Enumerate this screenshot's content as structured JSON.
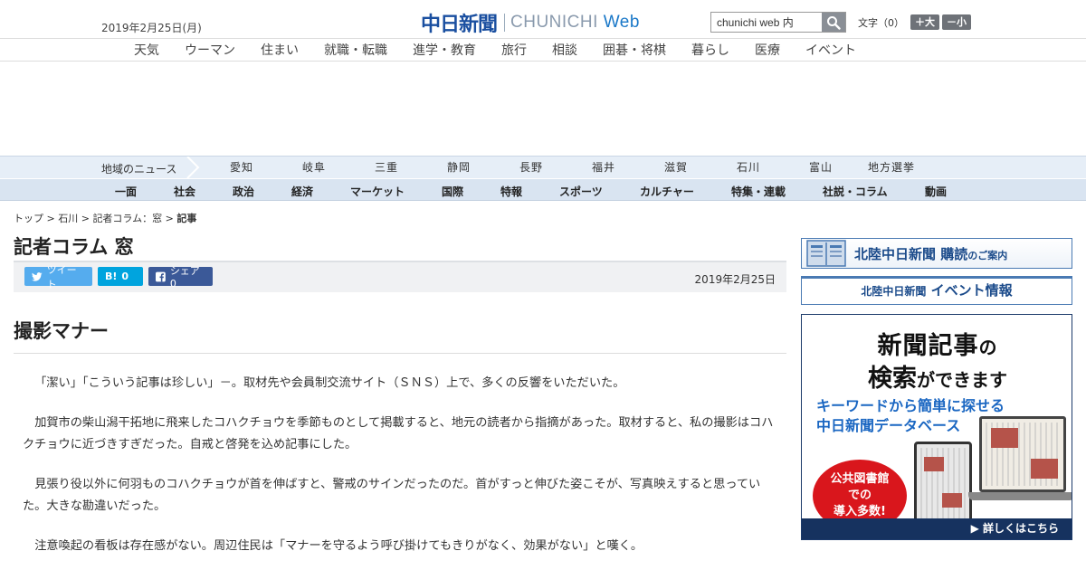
{
  "header": {
    "date": "2019年2月25日(月)",
    "logo_jp": "中日新聞",
    "logo_en_prefix": "CHUNICHI ",
    "logo_en_suffix": "Web",
    "search_value": "chunichi web 内",
    "fontsize_label": "文字",
    "fontsize_value": "（0）",
    "fontsize_plus": "＋大",
    "fontsize_minus": "－小"
  },
  "topnav": [
    "天気",
    "ウーマン",
    "住まい",
    "就職・転職",
    "進学・教育",
    "旅行",
    "相談",
    "囲碁・将棋",
    "暮らし",
    "医療",
    "イベント"
  ],
  "regionnav": {
    "label": "地域のニュース",
    "items": [
      "愛知",
      "岐阜",
      "三重",
      "静岡",
      "長野",
      "福井",
      "滋賀",
      "石川",
      "富山",
      "地方選挙"
    ]
  },
  "secnav": [
    "一面",
    "社会",
    "政治",
    "経済",
    "マーケット",
    "国際",
    "特報",
    "スポーツ",
    "カルチャー",
    "特集・連載",
    "社説・コラム",
    "動画"
  ],
  "breadcrumb": {
    "items": [
      "トップ",
      "石川",
      "記者コラム：窓"
    ],
    "current": "記事",
    "sep": " > "
  },
  "article": {
    "column_title": "記者コラム 窓",
    "share": {
      "tweet": "ツイート",
      "hatena": "0",
      "hatena_icon": "B!",
      "fb": "シェア 0"
    },
    "date": "2019年2月25日",
    "headline": "撮影マナー",
    "paragraphs": [
      "「潔い」「こういう記事は珍しい」－。取材先や会員制交流サイト（ＳＮＳ）上で、多くの反響をいただいた。",
      "加賀市の柴山潟干拓地に飛来したコハクチョウを季節ものとして掲載すると、地元の読者から指摘があった。取材すると、私の撮影はコハクチョウに近づきすぎだった。自戒と啓発を込め記事にした。",
      "見張り役以外に何羽ものコハクチョウが首を伸ばすと、警戒のサインだったのだ。首がすっと伸びた姿こそが、写真映えすると思っていた。大きな勘違いだった。",
      "注意喚起の看板は存在感がない。周辺住民は「マナーを守るよう呼び掛けてもきりがなく、効果がない」と嘆く。"
    ]
  },
  "sidebar": {
    "subscribe_main": "北陸中日新聞 購",
    "subscribe_em": "読",
    "subscribe_small": "のご案内",
    "event_prefix": "北陸中日新聞",
    "event_main": " イベント情報",
    "ad": {
      "line1_a": "新聞記事",
      "line1_b": "の",
      "line2_a": "検索",
      "line2_b": "ができます",
      "line3": "キーワードから簡単に探せる",
      "line4": "中日新聞データベース",
      "badge1": "公共図書館",
      "badge2": "での",
      "badge3": "導入多数!",
      "more": "▶ 詳しくはこちら"
    }
  },
  "colors": {
    "brand": "#1a4fa0",
    "region_bg": "#e6eef7",
    "section_bg": "#d9e4f1",
    "ad_red": "#d9161c",
    "ad_blue": "#1b67c2"
  }
}
